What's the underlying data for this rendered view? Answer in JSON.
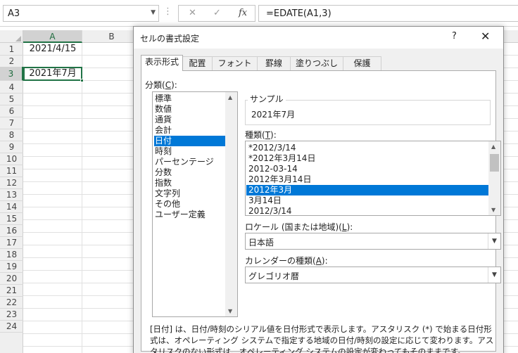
{
  "formula_bar": {
    "namebox": "A3",
    "cancel_icon": "✕",
    "enter_icon": "✓",
    "function_icon": "fx",
    "formula": "=EDATE(A1,3)"
  },
  "sheet": {
    "columns": [
      "A",
      "B"
    ],
    "rows": [
      "1",
      "2",
      "3",
      "4",
      "5",
      "6",
      "7",
      "8",
      "9",
      "10",
      "11",
      "12",
      "13",
      "14",
      "15",
      "16",
      "17",
      "18",
      "19",
      "20",
      "21",
      "22",
      "23",
      "24"
    ],
    "cells": {
      "A1": "2021/4/15",
      "A3": "2021年7月"
    },
    "selected_cell": "A3"
  },
  "dialog": {
    "title": "セルの書式設定",
    "help": "?",
    "close": "✕",
    "tabs": [
      "表示形式",
      "配置",
      "フォント",
      "罫線",
      "塗りつぶし",
      "保護"
    ],
    "active_tab": "表示形式",
    "category_label": "分類(C):",
    "category_label_key": "C",
    "categories": [
      "標準",
      "数値",
      "通貨",
      "会計",
      "日付",
      "時刻",
      "パーセンテージ",
      "分数",
      "指数",
      "文字列",
      "その他",
      "ユーザー定義"
    ],
    "selected_category": "日付",
    "sample_label": "サンプル",
    "sample_value": "2021年7月",
    "types_label": "種類(T):",
    "types_label_key": "T",
    "types": [
      "*2012/3/14",
      "*2012年3月14日",
      "2012-03-14",
      "2012年3月14日",
      "2012年3月",
      "3月14日",
      "2012/3/14"
    ],
    "selected_type": "2012年3月",
    "locale_label": "ロケール (国または地域)(L):",
    "locale_label_key": "L",
    "locale_value": "日本語",
    "calendar_label": "カレンダーの種類(A):",
    "calendar_label_key": "A",
    "calendar_value": "グレゴリオ暦",
    "description": "[日付] は、日付/時刻のシリアル値を日付形式で表示します。アスタリスク (*) で始まる日付形式は、オペレーティング システムで指定する地域の日付/時刻の設定に応じて変わります。アスタリスクのない形式は、オペレーティング システムの設定が変わってもそのままです。"
  },
  "colors": {
    "excel_green": "#217346",
    "selection_blue": "#0078d7"
  }
}
